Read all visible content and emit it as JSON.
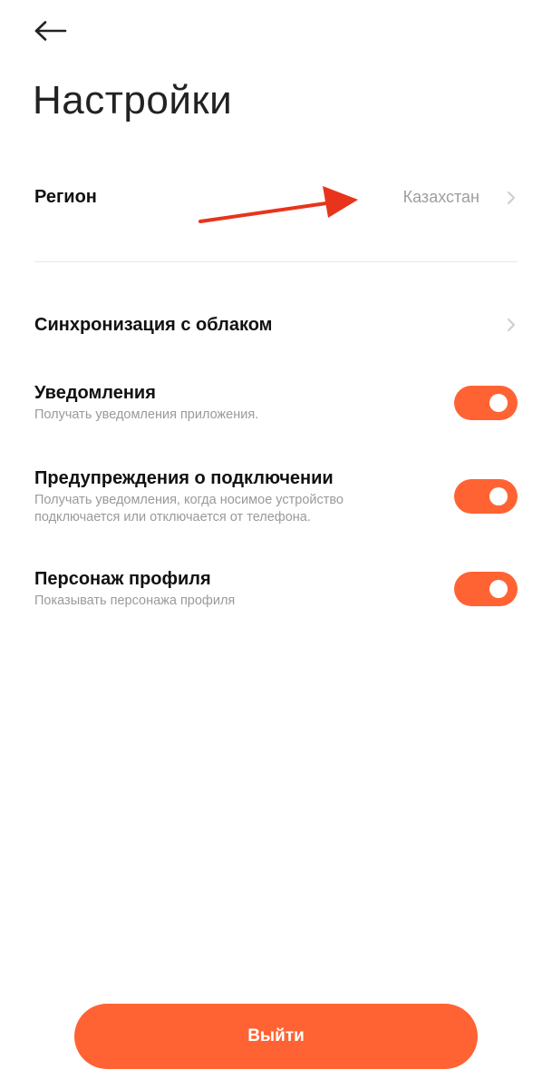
{
  "header": {
    "back_icon": "arrow-left-icon",
    "title": "Настройки"
  },
  "region": {
    "label": "Регион",
    "value": "Казахстан",
    "chevron_icon": "chevron-right-icon"
  },
  "annotation": {
    "icon": "red-arrow-icon",
    "color": "#e8341c"
  },
  "settings": {
    "cloud_sync": {
      "label": "Синхронизация с облаком",
      "chevron_icon": "chevron-right-icon"
    },
    "notifications": {
      "label": "Уведомления",
      "description": "Получать уведомления приложения.",
      "enabled": true
    },
    "connection_alerts": {
      "label": "Предупреждения о подключении",
      "description": "Получать уведомления, когда носимое устройство подключается или отключается от телефона.",
      "enabled": true
    },
    "profile_character": {
      "label": "Персонаж профиля",
      "description": "Показывать персонажа профиля",
      "enabled": true
    }
  },
  "logout": {
    "label": "Выйти"
  },
  "colors": {
    "accent": "#ff6333",
    "background": "#ffffff",
    "muted_text": "#9a9a9a"
  }
}
